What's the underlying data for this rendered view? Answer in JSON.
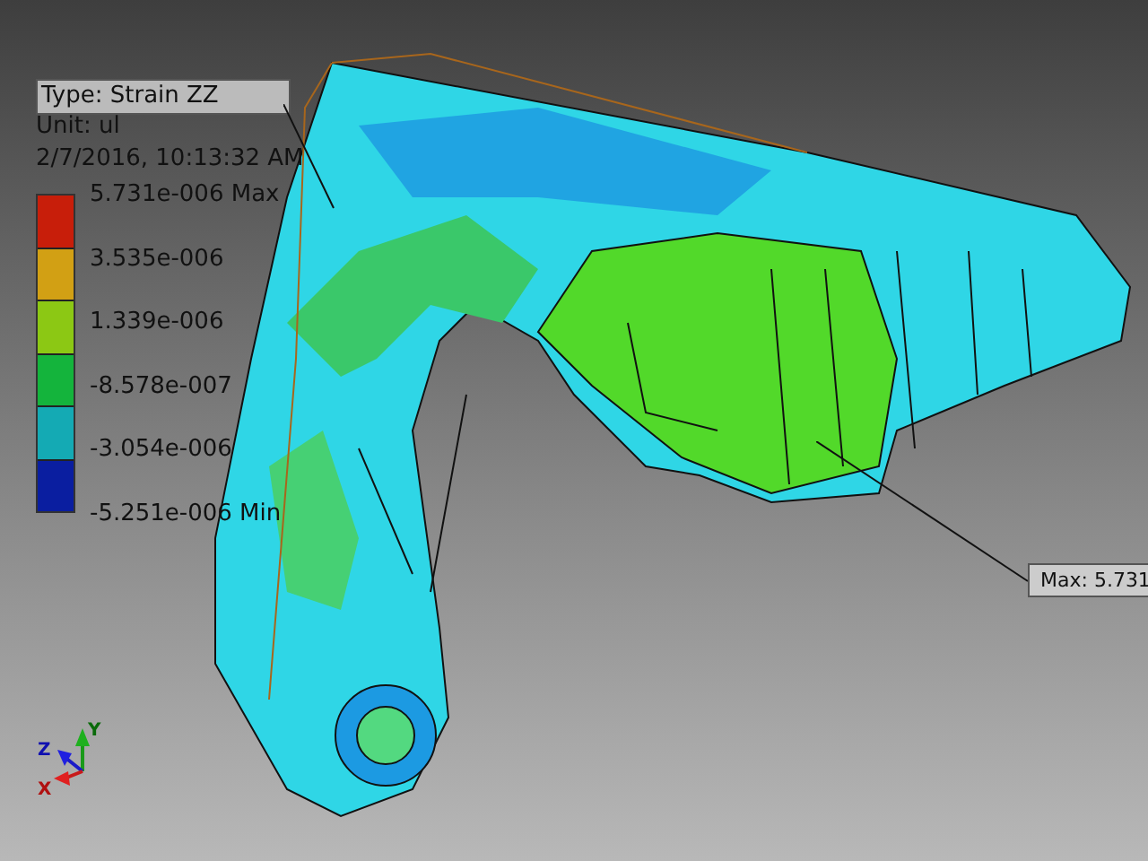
{
  "legend": {
    "type": "Type: Strain ZZ",
    "unit": "Unit: ul",
    "timestamp": "2/7/2016, 10:13:32 AM",
    "entries": [
      {
        "value": "5.731e-006 Max",
        "color": "#c81e0a"
      },
      {
        "value": "3.535e-006",
        "color": "#d2a014"
      },
      {
        "value": "1.339e-006",
        "color": "#8cc814"
      },
      {
        "value": "-8.578e-007",
        "color": "#14b43c"
      },
      {
        "value": "-3.054e-006",
        "color": "#14aab4"
      },
      {
        "value": "-5.251e-006 Min",
        "color": "#0a1ea0"
      }
    ]
  },
  "probes": [
    {
      "kind": "max",
      "label": "Max: 5.731"
    }
  ],
  "triad": {
    "x": "X",
    "y": "Y",
    "z": "Z"
  }
}
